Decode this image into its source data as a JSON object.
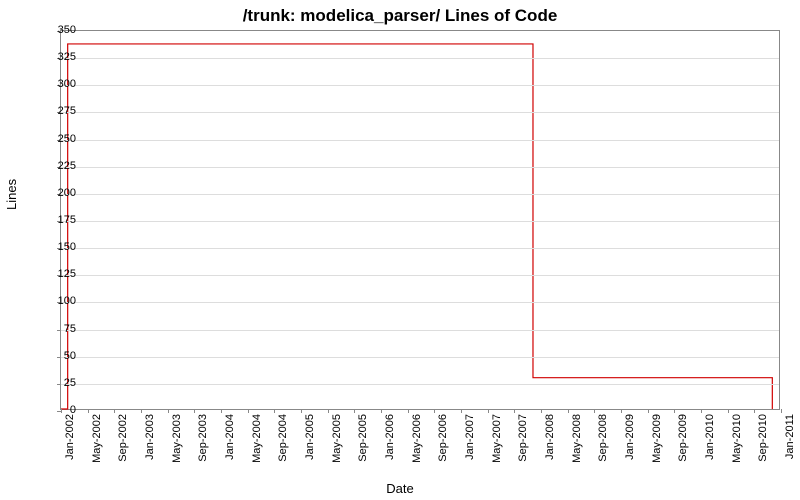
{
  "chart_data": {
    "type": "line",
    "title": "/trunk: modelica_parser/ Lines of Code",
    "xlabel": "Date",
    "ylabel": "Lines",
    "ylim": [
      0,
      350
    ],
    "yticks": [
      0,
      25,
      50,
      75,
      100,
      125,
      150,
      175,
      200,
      225,
      250,
      275,
      300,
      325,
      350
    ],
    "x_categories": [
      "Jan-2002",
      "May-2002",
      "Sep-2002",
      "Jan-2003",
      "May-2003",
      "Sep-2003",
      "Jan-2004",
      "May-2004",
      "Sep-2004",
      "Jan-2005",
      "May-2005",
      "Sep-2005",
      "Jan-2006",
      "May-2006",
      "Sep-2006",
      "Jan-2007",
      "May-2007",
      "Sep-2007",
      "Jan-2008",
      "May-2008",
      "Sep-2008",
      "Jan-2009",
      "May-2009",
      "Sep-2009",
      "Jan-2010",
      "May-2010",
      "Sep-2010",
      "Jan-2011"
    ],
    "series": [
      {
        "name": "Lines of Code",
        "color": "#d00000",
        "points": [
          {
            "x": "Jan-2002",
            "y": 0
          },
          {
            "x": "Feb-2002",
            "y": 0
          },
          {
            "x": "Feb-2002",
            "y": 338
          },
          {
            "x": "Dec-2007",
            "y": 338
          },
          {
            "x": "Dec-2007",
            "y": 29
          },
          {
            "x": "Dec-2010",
            "y": 29
          },
          {
            "x": "Dec-2010",
            "y": 25
          },
          {
            "x": "Dec-2010",
            "y": 0
          }
        ]
      }
    ]
  }
}
